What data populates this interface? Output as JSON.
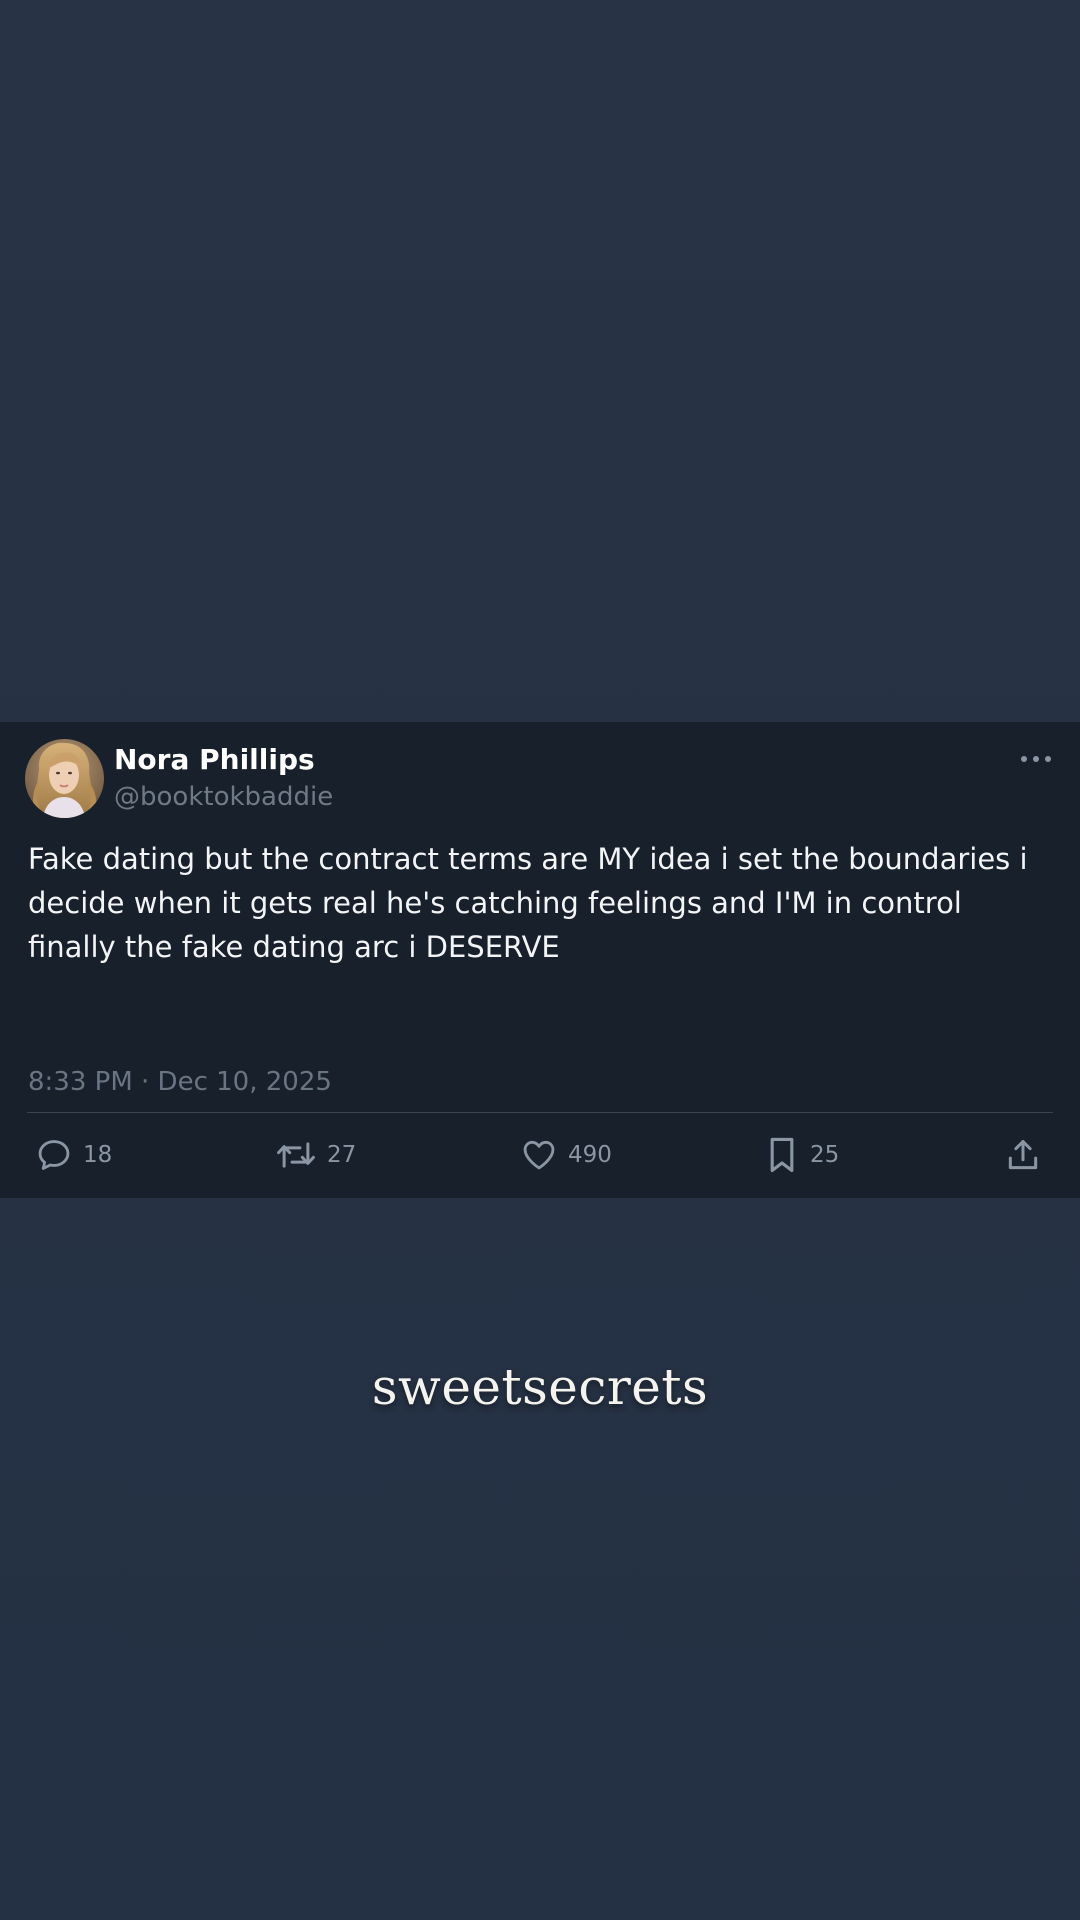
{
  "tweet": {
    "display_name": "Nora Phillips",
    "handle": "@booktokbaddie",
    "text": "Fake dating but the contract terms are MY idea i set the boundaries i decide when it gets real he's catching feelings and I'M in control finally the fake dating arc i DESERVE",
    "timestamp": "8:33 PM · Dec 10, 2025",
    "actions": {
      "reply": {
        "icon": "comment-icon",
        "count": "18"
      },
      "retweet": {
        "icon": "retweet-icon",
        "count": "27"
      },
      "like": {
        "icon": "heart-icon",
        "count": "490"
      },
      "bookmark": {
        "icon": "bookmark-icon",
        "count": "25"
      },
      "share": {
        "icon": "share-icon"
      }
    },
    "more_icon": "ellipsis-icon"
  },
  "brand": {
    "watermark": "sweetsecrets"
  },
  "colors": {
    "background": "#283445",
    "card": "#18202b",
    "text_primary": "#f2f4f6",
    "text_secondary": "#6f7a87",
    "icon": "#8a96a4"
  }
}
